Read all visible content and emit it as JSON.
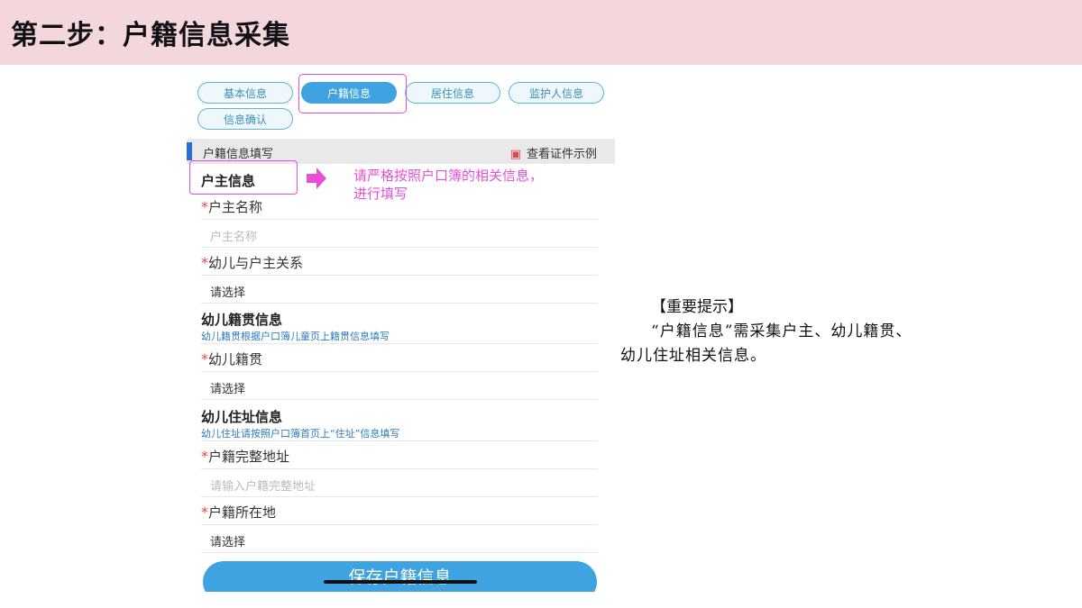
{
  "header": {
    "title": "第二步：户籍信息采集"
  },
  "tabs": [
    {
      "label": "基本信息",
      "active": false
    },
    {
      "label": "户籍信息",
      "active": true
    },
    {
      "label": "居住信息",
      "active": false
    },
    {
      "label": "监护人信息",
      "active": false
    },
    {
      "label": "信息确认",
      "active": false
    }
  ],
  "section": {
    "title": "户籍信息填写",
    "sample_link": "查看证件示例"
  },
  "household_head": {
    "title": "户主信息",
    "name_label": "户主名称",
    "name_placeholder": "户主名称",
    "relation_label": "幼儿与户主关系",
    "relation_value": "请选择"
  },
  "native_place": {
    "title": "幼儿籍贯信息",
    "note": "幼儿籍贯根据户口簿儿童页上籍贯信息填写",
    "label": "幼儿籍贯",
    "value": "请选择"
  },
  "address": {
    "title": "幼儿住址信息",
    "note": "幼儿住址请按照户口簿首页上“住址”信息填写",
    "full_label": "户籍完整地址",
    "full_placeholder": "请输入户籍完整地址",
    "location_label": "户籍所在地",
    "location_value": "请选择"
  },
  "save_button": "保存户籍信息",
  "callout": {
    "text": "请严格按照户口簿的相关信息，进行填写",
    "color": "#e84fd6"
  },
  "tip": {
    "heading": "【重要提示】",
    "body": "“户籍信息”需采集户主、幼儿籍贯、幼儿住址相关信息。"
  },
  "colors": {
    "header_bg": "#f4d6dd",
    "accent_blue": "#3ea3e0",
    "required_star": "#e0474b"
  }
}
